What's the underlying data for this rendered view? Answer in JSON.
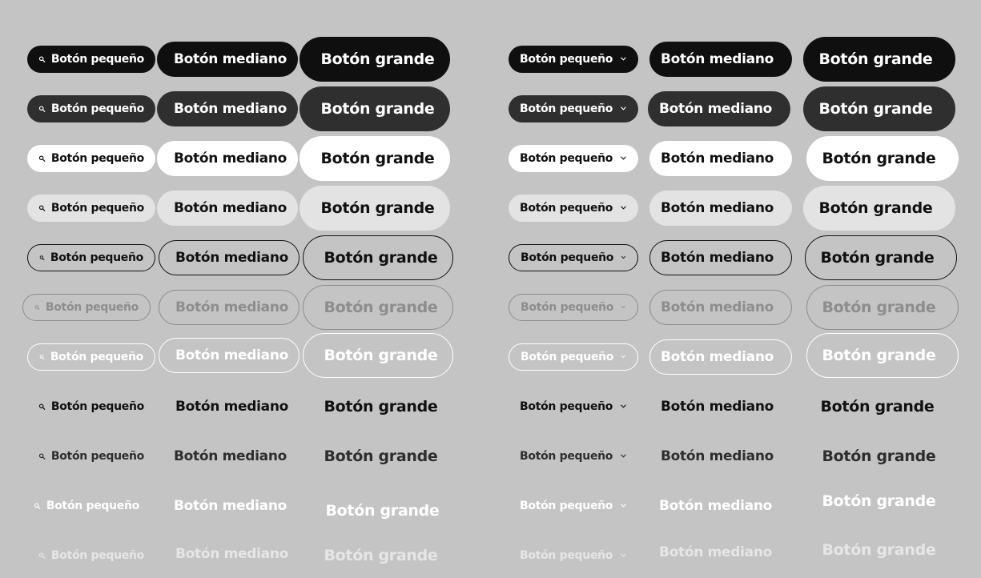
{
  "labels": {
    "small": "Botón pequeño",
    "medium": "Botón mediano",
    "large": "Botón grande"
  },
  "icons": {
    "leading": "search-icon",
    "trailing": "chevron-down-icon"
  },
  "variants": [
    "primary",
    "dark",
    "white",
    "light",
    "outline",
    "outline-muted",
    "outline-white",
    "ghost",
    "ghost-dark",
    "ghost-white",
    "ghost-faded"
  ],
  "colors": {
    "background": "#c4c4c4",
    "primary": "#0f0f0f",
    "dark": "#2f2f2f",
    "white": "#ffffff",
    "light": "#e3e3e3",
    "muted": "#8d8d8d"
  }
}
